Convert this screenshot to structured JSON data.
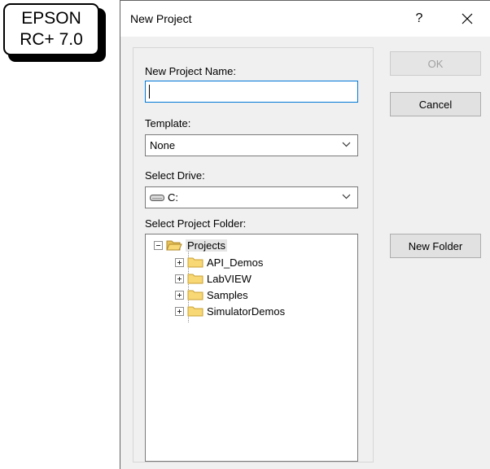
{
  "badge": {
    "line1": "EPSON",
    "line2": "RC+ 7.0"
  },
  "dialog": {
    "title": "New Project",
    "help_label": "?",
    "close_icon": "close-icon"
  },
  "form": {
    "name_label": "New Project Name:",
    "name_value": "",
    "template_label": "Template:",
    "template_value": "None",
    "drive_label": "Select Drive:",
    "drive_value": "C:",
    "folder_label": "Select Project Folder:"
  },
  "tree": {
    "root": "Projects",
    "children": [
      "API_Demos",
      "LabVIEW",
      "Samples",
      "SimulatorDemos"
    ]
  },
  "buttons": {
    "ok": "OK",
    "cancel": "Cancel",
    "new_folder": "New Folder"
  },
  "colors": {
    "focus_border": "#0078d7",
    "folder_fill": "#f8d775",
    "folder_stroke": "#c8a032"
  }
}
